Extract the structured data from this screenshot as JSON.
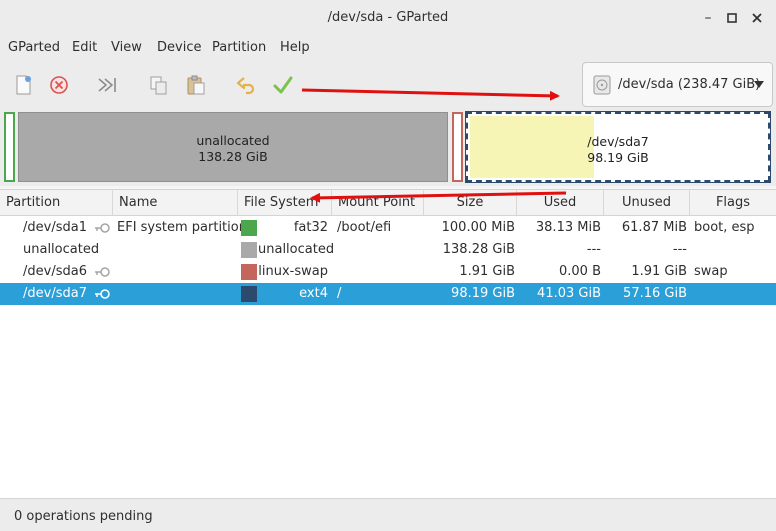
{
  "window": {
    "title": "/dev/sda - GParted"
  },
  "menu": [
    "GParted",
    "Edit",
    "View",
    "Device",
    "Partition",
    "Help"
  ],
  "toolbar": {
    "icons": [
      "new-partition-icon",
      "delete-partition-icon",
      "resize-move-icon",
      "copy-icon",
      "paste-icon",
      "undo-icon",
      "apply-icon"
    ]
  },
  "device": {
    "label": "/dev/sda  (238.47 GiB)"
  },
  "diskmap": {
    "segments": [
      {
        "name": "unallocated",
        "size": "138.28 GiB"
      },
      {
        "name": "/dev/sda7",
        "size": "98.19 GiB",
        "used_fraction": 0.418
      }
    ]
  },
  "table": {
    "headers": [
      "Partition",
      "Name",
      "File System",
      "Mount Point",
      "Size",
      "Used",
      "Unused",
      "Flags"
    ],
    "rows": [
      {
        "partition": "/dev/sda1",
        "name": "EFI system partition",
        "fs": "fat32",
        "fs_color": "#4ca64c",
        "mount": "/boot/efi",
        "size": "100.00 MiB",
        "used": "38.13 MiB",
        "unused": "61.87 MiB",
        "flags": "boot, esp"
      },
      {
        "partition": "unallocated",
        "name": "",
        "fs": "unallocated",
        "fs_color": "#a9a9a9",
        "mount": "",
        "size": "138.28 GiB",
        "used": "---",
        "unused": "---",
        "flags": ""
      },
      {
        "partition": "/dev/sda6",
        "name": "",
        "fs": "linux-swap",
        "fs_color": "#c4665c",
        "mount": "",
        "size": "1.91 GiB",
        "used": "0.00 B",
        "unused": "1.91 GiB",
        "flags": "swap"
      },
      {
        "partition": "/dev/sda7",
        "name": "",
        "fs": "ext4",
        "fs_color": "#2b4a6e",
        "mount": "/",
        "size": "98.19 GiB",
        "used": "41.03 GiB",
        "unused": "57.16 GiB",
        "flags": ""
      }
    ]
  },
  "status": {
    "text": "0 operations pending"
  },
  "colors": {
    "selection": "#2a9fd8",
    "annotation_arrow": "#e01010"
  }
}
